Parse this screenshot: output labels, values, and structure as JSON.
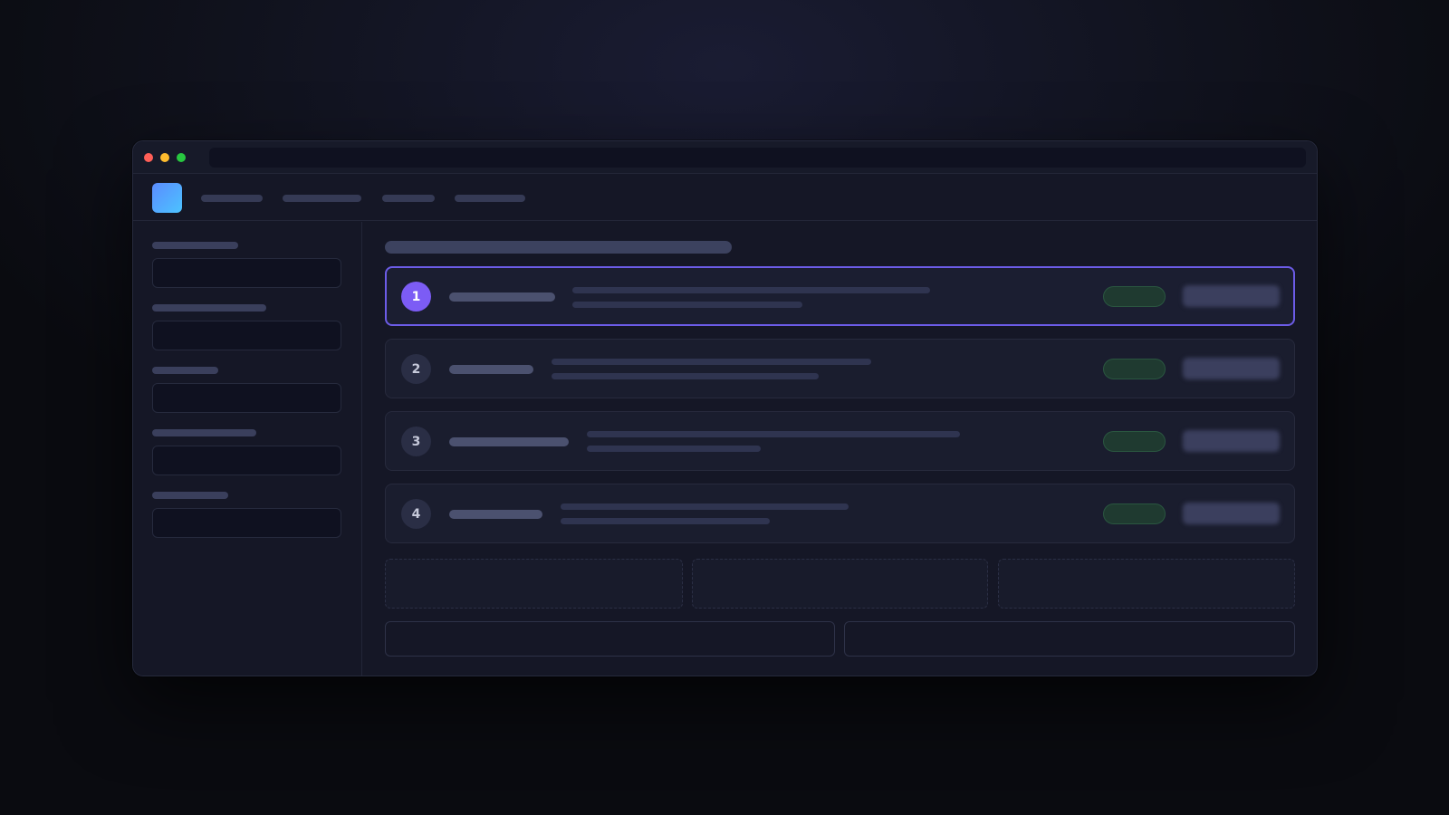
{
  "window": {
    "traffic_lights": [
      {
        "name": "close",
        "color": "#ff5f57"
      },
      {
        "name": "minimize",
        "color": "#febc2e"
      },
      {
        "name": "maximize",
        "color": "#28c840"
      }
    ]
  },
  "colors": {
    "accent": "#7c5cf5",
    "selected_border": "#6c5ce7",
    "status_ok": "#1f3a30",
    "logo_gradient": [
      "#5b8cff",
      "#4cc3ff"
    ],
    "primary_gradient": [
      "#7a5cff",
      "#3fc4ff"
    ]
  },
  "rows": [
    {
      "number": "1",
      "selected": true
    },
    {
      "number": "2",
      "selected": false
    },
    {
      "number": "3",
      "selected": false
    },
    {
      "number": "4",
      "selected": false
    }
  ]
}
